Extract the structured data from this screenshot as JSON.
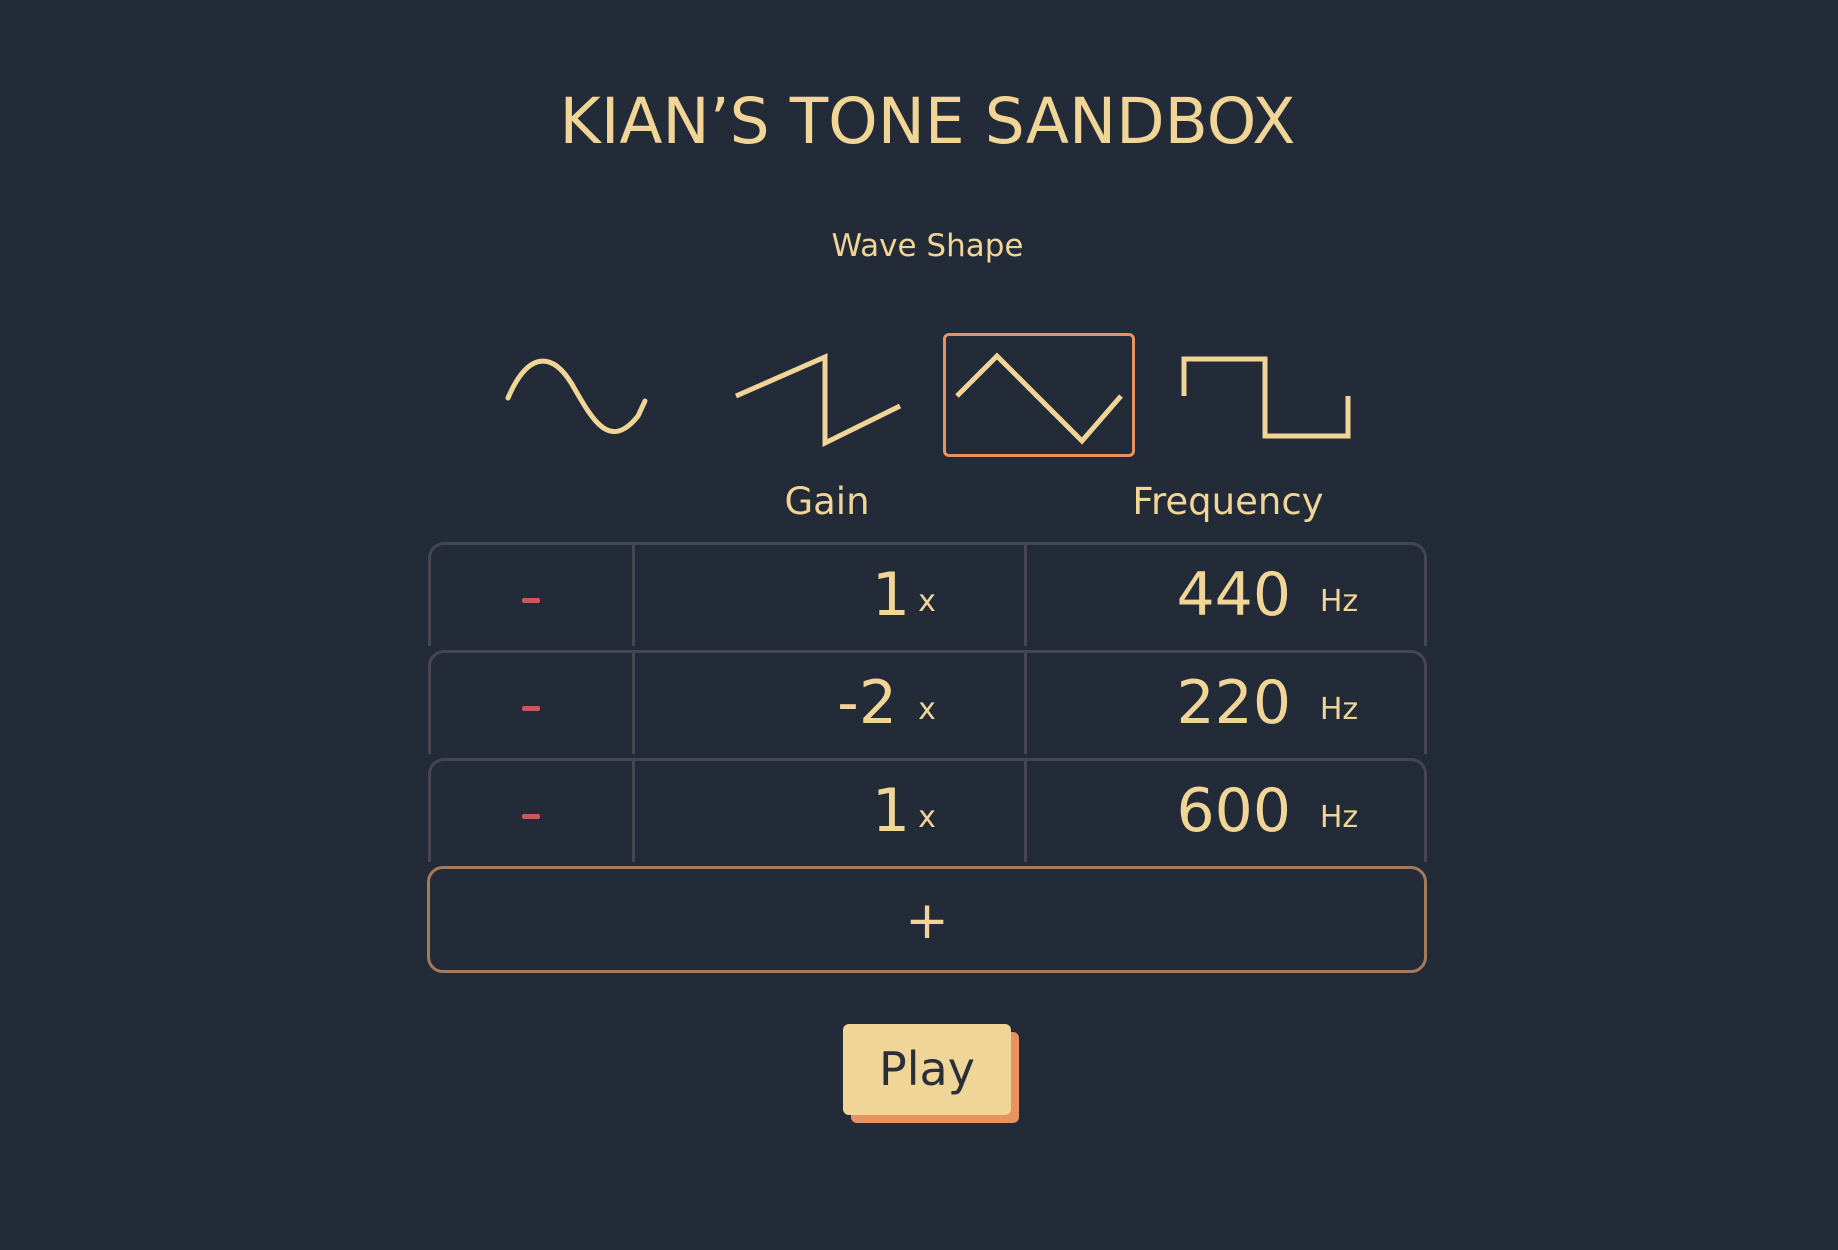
{
  "app": {
    "title": "KIAN’S TONE SANDBOX"
  },
  "wave_shape": {
    "label": "Wave Shape",
    "options": [
      {
        "name": "sine",
        "selected": false
      },
      {
        "name": "sawtooth",
        "selected": false
      },
      {
        "name": "triangle",
        "selected": true
      },
      {
        "name": "square",
        "selected": false
      }
    ]
  },
  "columns": {
    "gain": "Gain",
    "frequency": "Frequency"
  },
  "oscillators": [
    {
      "remove_label": "-",
      "gain": "1",
      "gain_unit": "x",
      "frequency": "440",
      "frequency_unit": "Hz"
    },
    {
      "remove_label": "-",
      "gain": "-2",
      "gain_unit": "x",
      "frequency": "220",
      "frequency_unit": "Hz"
    },
    {
      "remove_label": "-",
      "gain": "1",
      "gain_unit": "x",
      "frequency": "600",
      "frequency_unit": "Hz"
    }
  ],
  "add_button": {
    "label": "+"
  },
  "play_button": {
    "label": "Play"
  },
  "colors": {
    "background": "#232b38",
    "accent_text": "#f0d597",
    "selected_border": "#e8935f",
    "remove_color": "#c9585a",
    "play_bg": "#efd698",
    "play_shadow": "#e8935f"
  }
}
